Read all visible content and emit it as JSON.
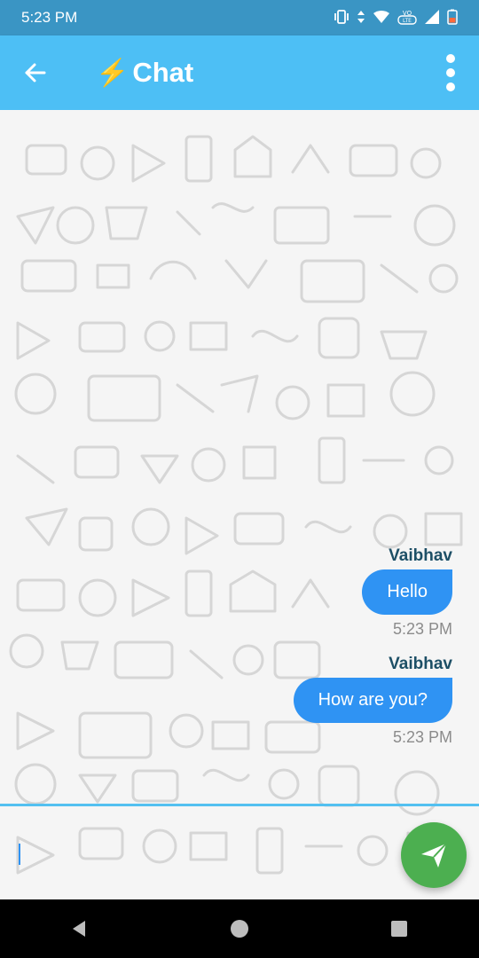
{
  "status_bar": {
    "time": "5:23 PM",
    "icons": [
      "vibrate-icon",
      "data-arrows-icon",
      "wifi-icon",
      "volte-icon",
      "signal-icon",
      "battery-icon"
    ],
    "volte_label": "VO LTE"
  },
  "app_bar": {
    "title": "Chat",
    "title_icon": "⚡",
    "accent_color": "#4dbff5"
  },
  "messages": [
    {
      "sender": "Vaibhav",
      "text": "Hello",
      "time": "5:23 PM"
    },
    {
      "sender": "Vaibhav",
      "text": "How are you?",
      "time": "5:23 PM"
    }
  ],
  "composer": {
    "value": "",
    "placeholder": ""
  },
  "colors": {
    "bubble": "#2f93f3",
    "send_button": "#4caf50",
    "status_bar": "#3a95c4"
  }
}
